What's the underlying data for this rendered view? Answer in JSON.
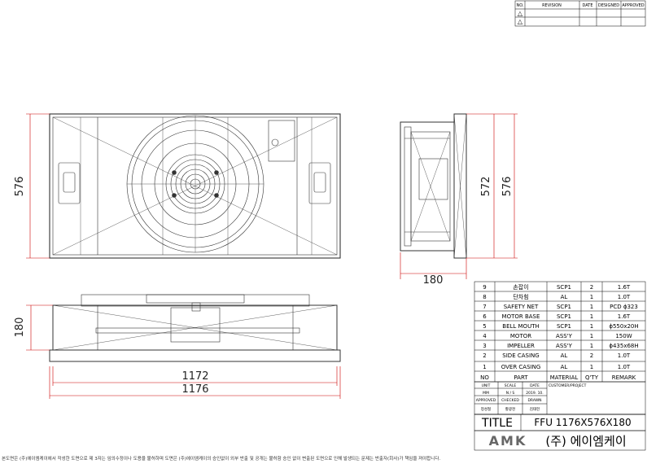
{
  "revision_table": {
    "headers": [
      "NO.",
      "REVISION",
      "DATE",
      "DESIGNED",
      "APPROVED"
    ],
    "rows": [
      "△",
      "△"
    ]
  },
  "dimensions": {
    "front_height": "576",
    "side_inner_height": "572",
    "side_outer_height": "576",
    "side_depth": "180",
    "bottom_height": "180",
    "inner_width": "1172",
    "outer_width": "1176"
  },
  "bom": {
    "rows": [
      {
        "no": "9",
        "part": "손잡이",
        "material": "SCP1",
        "qty": "2",
        "remark": "1.6T"
      },
      {
        "no": "8",
        "part": "단차힘",
        "material": "AL",
        "qty": "1",
        "remark": "1.0T"
      },
      {
        "no": "7",
        "part": "SAFETY NET",
        "material": "SCP1",
        "qty": "1",
        "remark": "PCD ϕ323"
      },
      {
        "no": "6",
        "part": "MOTOR BASE",
        "material": "SCP1",
        "qty": "1",
        "remark": "1.6T"
      },
      {
        "no": "5",
        "part": "BELL MOUTH",
        "material": "SCP1",
        "qty": "1",
        "remark": "ϕ550x20H"
      },
      {
        "no": "4",
        "part": "MOTOR",
        "material": "ASS'Y",
        "qty": "1",
        "remark": "150W"
      },
      {
        "no": "3",
        "part": "IMPELLER",
        "material": "ASS'Y",
        "qty": "1",
        "remark": "ϕ435x68H"
      },
      {
        "no": "2",
        "part": "SIDE CASING",
        "material": "AL",
        "qty": "2",
        "remark": "1.0T"
      },
      {
        "no": "1",
        "part": "OVER CASING",
        "material": "AL",
        "qty": "1",
        "remark": "1.0T"
      }
    ],
    "header": {
      "no": "NO",
      "part": "PART",
      "material": "MATERIAL",
      "qty": "Q'TY",
      "remark": "REMARK"
    }
  },
  "title_block": {
    "unit_label": "UNIT",
    "scale_label": "SCALE",
    "date_label": "DATE",
    "customer_label": "CUSTOMER/PROJECT",
    "unit": "MM",
    "scale": "N / S",
    "date": "2019. 10.",
    "approved_label": "APPROVED",
    "checked_label": "CHECKED",
    "drawn_label": "DRAWN",
    "approved": "정성철",
    "checked": "황광천",
    "drawn": "김태헌",
    "title_label": "TITLE",
    "title": "FFU  1176X576X180",
    "logo": "AMK",
    "company": "(주) 에이엠케이"
  },
  "footer": "본도면은 (주)에이엠케이에서 작성한 도면으로 제 3자는 임의수정이나 도용을 불허하며 도면은 (주)에이엠케이의 승인없이 외부 반출 및 공개는 불허함 승인 없이 변출된 도면으로 인해 발생되는 문제는 반출자(회사)가 책임을 져야합니다."
}
